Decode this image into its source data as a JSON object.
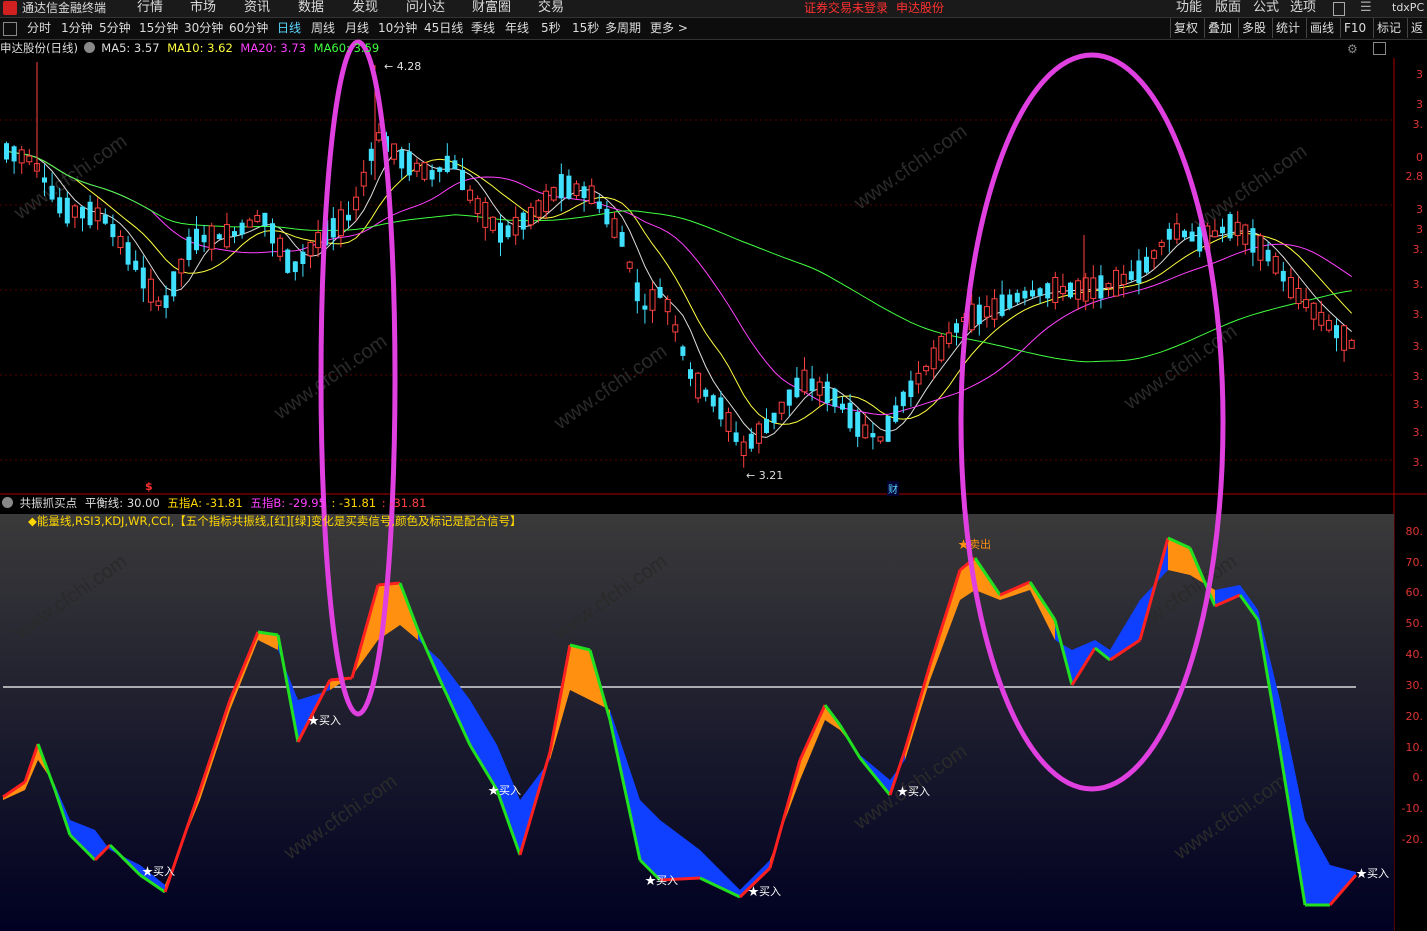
{
  "menubar": {
    "app_title": "通达信金融终端",
    "items": [
      "行情",
      "市场",
      "资讯",
      "数据",
      "发现",
      "问小达",
      "财富圈",
      "交易"
    ],
    "notice": "证券交易未登录",
    "notice_stock": "申达股份",
    "right_items": [
      "功能",
      "版面",
      "公式",
      "选项"
    ],
    "right_brand": "tdxPC"
  },
  "periods": {
    "items": [
      "分时",
      "1分钟",
      "5分钟",
      "15分钟",
      "30分钟",
      "60分钟",
      "日线",
      "周线",
      "月线",
      "10分钟",
      "45日线",
      "季线",
      "年线",
      "5秒",
      "15秒",
      "多周期",
      "更多 >"
    ],
    "active": "日线"
  },
  "tools": [
    "复权",
    "叠加",
    "多股",
    "统计",
    "画线",
    "F10",
    "标记",
    "返"
  ],
  "main_chart": {
    "stock": "申达股份(日线)",
    "ma": [
      {
        "label": "MA5: 3.57",
        "color": "#dddddd"
      },
      {
        "label": "MA10: 3.62",
        "color": "#ffff40"
      },
      {
        "label": "MA20: 3.73",
        "color": "#ff40ff"
      },
      {
        "label": "MA60: 3.59",
        "color": "#40ff40"
      }
    ],
    "high_label": "4.28",
    "low_label": "3.21",
    "cai_label": "财",
    "dollar": "$",
    "axis_right": [
      "3",
      "3",
      "3.",
      "0",
      "2.8",
      "3",
      "3",
      "3.",
      "3.",
      "3.",
      "3.",
      "3.",
      "3.",
      "3.",
      "3."
    ]
  },
  "indicator": {
    "name": "共振抓买点",
    "balance": "平衡线: 30.00",
    "idx_a": "五指A: -31.81",
    "idx_b": "五指B: -29.95",
    "v3": ": -31.81",
    "v4": ": -31.81",
    "desc": "◆能量线,RSI3,KDJ,WR,CCI,【五个指标共振线,[红][绿]变化是买卖信号,颜色及标记是配合信号】",
    "buy_label": "★买入",
    "sell_label": "★卖出",
    "axis_right": [
      "80.",
      "70.",
      "60.",
      "50.",
      "40.",
      "30.",
      "20.",
      "10.",
      "0.",
      "-10.",
      "-20."
    ]
  },
  "watermark": "www.cfchi.com"
}
